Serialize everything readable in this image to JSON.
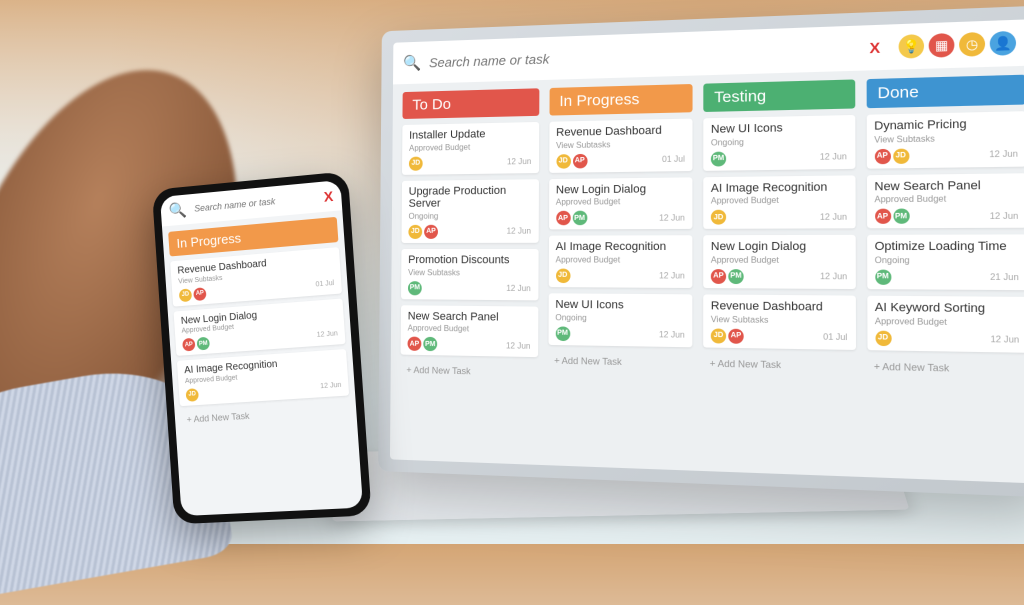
{
  "search": {
    "placeholder": "Search name or task",
    "clear": "X"
  },
  "top_icons": [
    {
      "name": "idea-icon",
      "bg": "#f4c94b",
      "glyph": "💡"
    },
    {
      "name": "calendar-icon",
      "bg": "#e1564b",
      "glyph": "▦"
    },
    {
      "name": "clock-icon",
      "bg": "#f0b93a",
      "glyph": "◷"
    },
    {
      "name": "avatar-icon",
      "bg": "#4aa3e0",
      "glyph": "👤"
    }
  ],
  "columns": [
    {
      "id": "todo",
      "title": "To Do",
      "color": "#e1564b",
      "cards": [
        {
          "title": "Installer Update",
          "sub": "Approved Budget",
          "avs": [
            {
              "t": "JD",
              "c": "#f0b93a"
            }
          ],
          "date": "12 Jun"
        },
        {
          "title": "Upgrade Production Server",
          "sub": "Ongoing",
          "avs": [
            {
              "t": "JD",
              "c": "#f0b93a"
            },
            {
              "t": "AP",
              "c": "#e1564b"
            }
          ],
          "date": "12 Jun"
        },
        {
          "title": "Promotion Discounts",
          "sub": "View Subtasks",
          "avs": [
            {
              "t": "PM",
              "c": "#5fb97a"
            }
          ],
          "date": "12 Jun"
        },
        {
          "title": "New Search Panel",
          "sub": "Approved Budget",
          "avs": [
            {
              "t": "AP",
              "c": "#e1564b"
            },
            {
              "t": "PM",
              "c": "#5fb97a"
            }
          ],
          "date": "12 Jun"
        }
      ]
    },
    {
      "id": "inprogress",
      "title": "In Progress",
      "color": "#f2994a",
      "cards": [
        {
          "title": "Revenue Dashboard",
          "sub": "View Subtasks",
          "avs": [
            {
              "t": "JD",
              "c": "#f0b93a"
            },
            {
              "t": "AP",
              "c": "#e1564b"
            }
          ],
          "date": "01 Jul"
        },
        {
          "title": "New Login Dialog",
          "sub": "Approved Budget",
          "avs": [
            {
              "t": "AP",
              "c": "#e1564b"
            },
            {
              "t": "PM",
              "c": "#5fb97a"
            }
          ],
          "date": "12 Jun"
        },
        {
          "title": "AI Image Recognition",
          "sub": "Approved Budget",
          "avs": [
            {
              "t": "JD",
              "c": "#f0b93a"
            }
          ],
          "date": "12 Jun"
        },
        {
          "title": "New UI Icons",
          "sub": "Ongoing",
          "avs": [
            {
              "t": "PM",
              "c": "#5fb97a"
            }
          ],
          "date": "12 Jun"
        }
      ]
    },
    {
      "id": "testing",
      "title": "Testing",
      "color": "#4cb072",
      "cards": [
        {
          "title": "New UI Icons",
          "sub": "Ongoing",
          "avs": [
            {
              "t": "PM",
              "c": "#5fb97a"
            }
          ],
          "date": "12 Jun"
        },
        {
          "title": "AI Image Recognition",
          "sub": "Approved Budget",
          "avs": [
            {
              "t": "JD",
              "c": "#f0b93a"
            }
          ],
          "date": "12 Jun"
        },
        {
          "title": "New Login Dialog",
          "sub": "Approved Budget",
          "avs": [
            {
              "t": "AP",
              "c": "#e1564b"
            },
            {
              "t": "PM",
              "c": "#5fb97a"
            }
          ],
          "date": "12 Jun"
        },
        {
          "title": "Revenue Dashboard",
          "sub": "View Subtasks",
          "avs": [
            {
              "t": "JD",
              "c": "#f0b93a"
            },
            {
              "t": "AP",
              "c": "#e1564b"
            }
          ],
          "date": "01 Jul"
        }
      ]
    },
    {
      "id": "done",
      "title": "Done",
      "color": "#3e94d1",
      "cards": [
        {
          "title": "Dynamic Pricing",
          "sub": "View Subtasks",
          "avs": [
            {
              "t": "AP",
              "c": "#e1564b"
            },
            {
              "t": "JD",
              "c": "#f0b93a"
            }
          ],
          "date": "12 Jun"
        },
        {
          "title": "New Search Panel",
          "sub": "Approved Budget",
          "avs": [
            {
              "t": "AP",
              "c": "#e1564b"
            },
            {
              "t": "PM",
              "c": "#5fb97a"
            }
          ],
          "date": "12 Jun"
        },
        {
          "title": "Optimize Loading Time",
          "sub": "Ongoing",
          "avs": [
            {
              "t": "PM",
              "c": "#5fb97a"
            }
          ],
          "date": "21 Jun"
        },
        {
          "title": "AI Keyword Sorting",
          "sub": "Approved Budget",
          "avs": [
            {
              "t": "JD",
              "c": "#f0b93a"
            }
          ],
          "date": "12 Jun"
        }
      ]
    }
  ],
  "add_task_label": "+ Add New Task",
  "phone": {
    "column": {
      "title": "In Progress",
      "color": "#f2994a",
      "cards": [
        {
          "title": "Revenue Dashboard",
          "sub": "View Subtasks",
          "avs": [
            {
              "t": "JD",
              "c": "#f0b93a"
            },
            {
              "t": "AP",
              "c": "#e1564b"
            }
          ],
          "date": "01 Jul"
        },
        {
          "title": "New Login Dialog",
          "sub": "Approved Budget",
          "avs": [
            {
              "t": "AP",
              "c": "#e1564b"
            },
            {
              "t": "PM",
              "c": "#5fb97a"
            }
          ],
          "date": "12 Jun"
        },
        {
          "title": "AI Image Recognition",
          "sub": "Approved Budget",
          "avs": [
            {
              "t": "JD",
              "c": "#f0b93a"
            }
          ],
          "date": "12 Jun"
        }
      ]
    }
  }
}
